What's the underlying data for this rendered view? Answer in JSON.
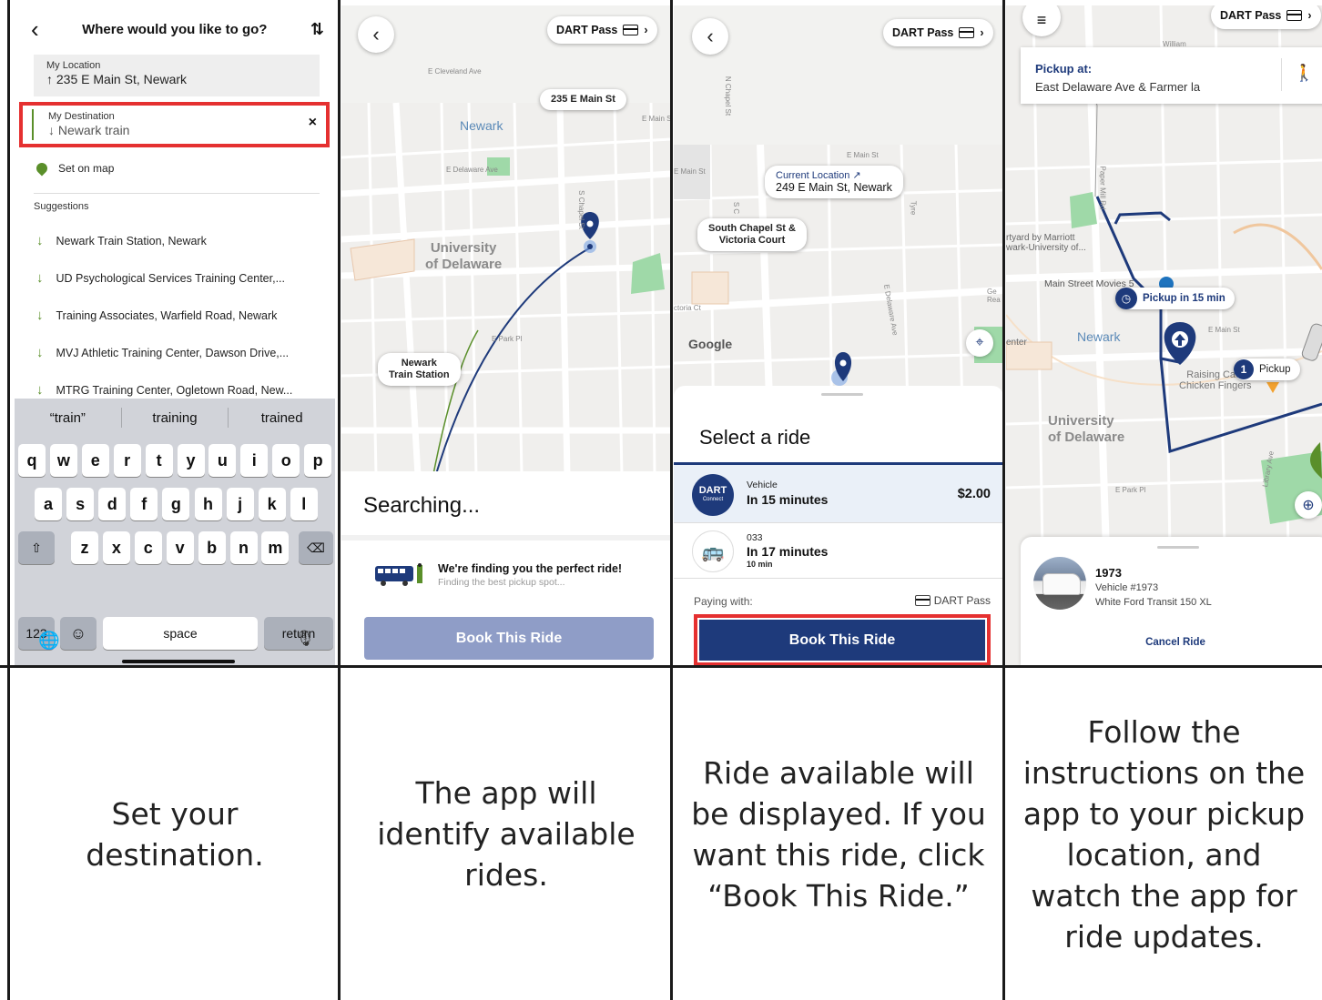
{
  "panel1": {
    "title": "Where would you like to go?",
    "back_icon": "chevron-left-icon",
    "sort_icon": "swap-vertical-icon",
    "origin": {
      "label": "My Location",
      "value": "↑ 235 E Main St, Newark"
    },
    "destination": {
      "label": "My Destination",
      "value": "↓ Newark train",
      "clear": "×"
    },
    "set_on_map": "Set on map",
    "suggestions_title": "Suggestions",
    "suggestions": [
      "Newark Train Station, Newark",
      "UD Psychological Services Training Center,...",
      "Training Associates, Warfield Road, Newark",
      "MVJ Athletic Training Center, Dawson Drive,...",
      "MTRG Training Center, Ogletown Road, New..."
    ],
    "keyboard": {
      "predictions": [
        "“train”",
        "training",
        "trained"
      ],
      "row1": [
        "q",
        "w",
        "e",
        "r",
        "t",
        "y",
        "u",
        "i",
        "o",
        "p"
      ],
      "row2": [
        "a",
        "s",
        "d",
        "f",
        "g",
        "h",
        "j",
        "k",
        "l"
      ],
      "row3": [
        "z",
        "x",
        "c",
        "v",
        "b",
        "n",
        "m"
      ],
      "shift": "⇧",
      "backspace": "⌫",
      "numbers": "123",
      "emoji": "☺",
      "space": "space",
      "return": "return",
      "globe": "🌐",
      "mic": "🎙"
    }
  },
  "panel2": {
    "back": "‹",
    "pass": "DART Pass",
    "pass_chevron": "›",
    "origin_callout": "235 E Main St",
    "dest_callout": "Newark\nTrain Station",
    "map_labels": {
      "city": "Newark",
      "university": "University\nof Delaware",
      "e_cleveland": "E Cleveland Ave",
      "e_main": "E Main St",
      "e_delaware": "E Delaware Ave",
      "e_park": "E Park Pl",
      "s_chapel": "S Chapel St"
    },
    "searching": "Searching...",
    "finding_title": "We're finding you the perfect ride!",
    "finding_sub": "Finding the best pickup spot...",
    "book": "Book This Ride"
  },
  "panel3": {
    "back": "‹",
    "pass": "DART Pass",
    "pass_chevron": "›",
    "current_label": "Current Location ↗",
    "current_value": "249 E Main St, Newark",
    "pickup_callout": "South Chapel St &\nVictoria Court",
    "map_labels": {
      "e_main": "E Main St",
      "e_main2": "E Main St",
      "n_chapel": "N Chapel St",
      "s_chapel": "S C",
      "victoria": "ctoria Ct",
      "e_delaware": "E Delaware Ave",
      "tyre": "Tyre",
      "google": "Google",
      "ge": "Ge\nRea"
    },
    "select_title": "Select a ride",
    "ride1": {
      "badge": "DART",
      "badge_sub": "Connect",
      "label": "Vehicle",
      "eta": "In 15 minutes",
      "price": "$2.00"
    },
    "ride2": {
      "label": "033",
      "eta": "In 17 minutes",
      "duration": "10 min"
    },
    "paying_with": "Paying with:",
    "pay_method": "DART Pass",
    "book": "Book This Ride"
  },
  "panel4": {
    "menu": "≡",
    "pass": "DART Pass",
    "pass_chevron": "›",
    "pickup_label": "Pickup at:",
    "pickup_value": "East Delaware Ave & Farmer la",
    "walk_icon": "🚶",
    "pickup_eta": "Pickup in 15 min",
    "pickup_marker_number": "1",
    "pickup_marker_label": "Pickup",
    "map_labels": {
      "marriott": "rtyard by Marriott\nwark-University of...",
      "main_street": "Main Street Movies 5",
      "city": "Newark",
      "enter": "enter",
      "raising": "Raising Ca...\nChicken Fingers",
      "university": "University\nof Delaware",
      "e_park": "E Park Pl",
      "library": "Library Ave",
      "paper_mill": "Paper Mill Rd",
      "william": "William",
      "e_main": "E Main St"
    },
    "vehicle_no": "1973",
    "vehicle_id": "Vehicle #1973",
    "vehicle_desc": "White Ford Transit 150 XL",
    "cancel": "Cancel Ride"
  },
  "captions": [
    "Set your destination.",
    "The app will identify available rides.",
    "Ride available will be displayed. If you want this ride, click “Book This Ride.”",
    "Follow the instructions on the app to your pickup location, and watch the app for ride updates."
  ],
  "colors": {
    "highlight": "#e53030",
    "dart_blue": "#1e3a7b",
    "green": "#5a8f2a"
  }
}
